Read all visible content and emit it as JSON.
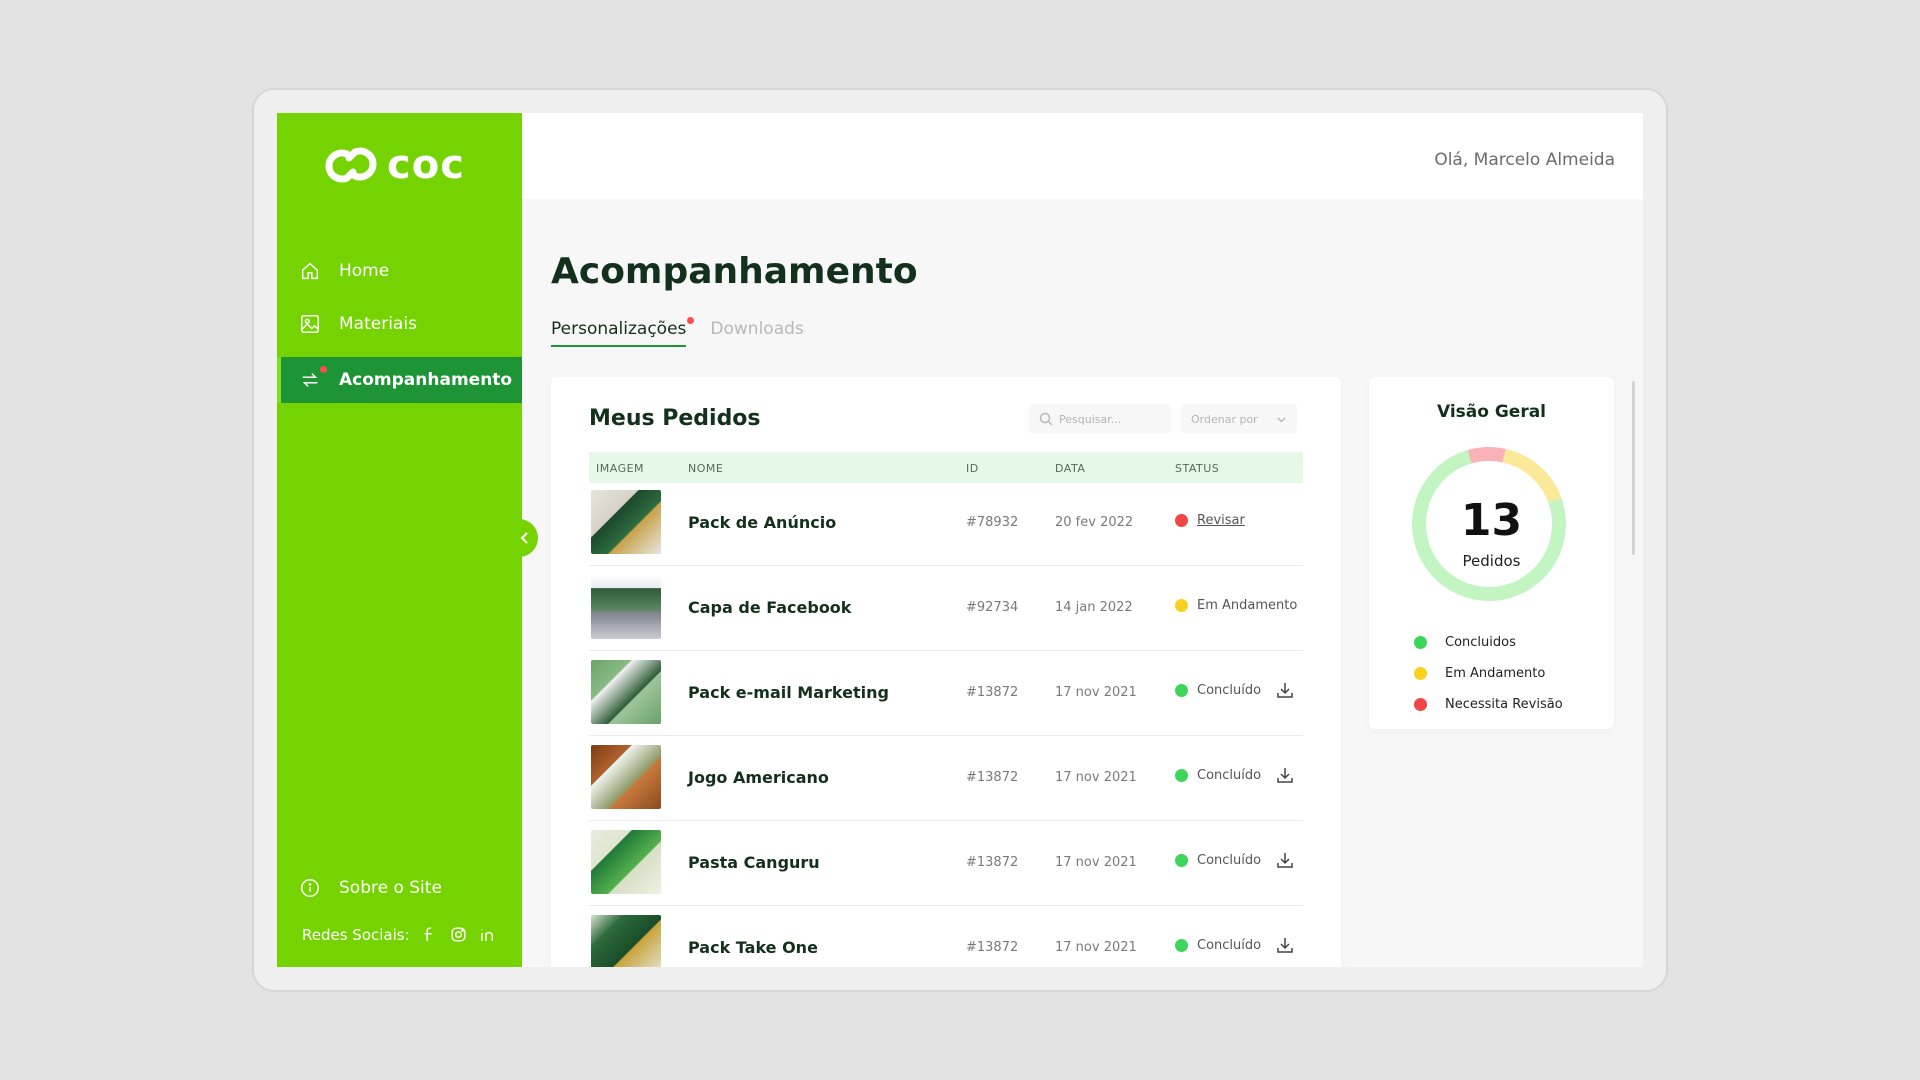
{
  "brand": {
    "logo_text": "coc",
    "primary": "#74d300",
    "active": "#1d9536"
  },
  "sidebar": {
    "items": [
      {
        "label": "Home",
        "icon": "home-icon"
      },
      {
        "label": "Materiais",
        "icon": "image-icon"
      },
      {
        "label": "Acompanhamento",
        "icon": "sync-icon",
        "active": true
      }
    ],
    "about_label": "Sobre o Site",
    "social_label": "Redes Sociais:",
    "social_icons": [
      "facebook-icon",
      "instagram-icon",
      "linkedin-icon"
    ]
  },
  "header": {
    "greeting": "Olá, Marcelo Almeida"
  },
  "page": {
    "title": "Acompanhamento",
    "tabs": [
      {
        "label": "Personalizações",
        "active": true
      },
      {
        "label": "Downloads",
        "active": false
      }
    ]
  },
  "orders": {
    "title": "Meus Pedidos",
    "search_placeholder": "Pesquisar...",
    "sort_label": "Ordenar por",
    "columns": [
      "IMAGEM",
      "NOME",
      "ID",
      "DATA",
      "STATUS"
    ],
    "rows": [
      {
        "name": "Pack de Anúncio",
        "id": "#78932",
        "date": "20 fev 2022",
        "status": "Revisar",
        "status_color": "#f04646",
        "download": false
      },
      {
        "name": "Capa de Facebook",
        "id": "#92734",
        "date": "14 jan 2022",
        "status": "Em Andamento",
        "status_color": "#f7d21e",
        "download": false
      },
      {
        "name": "Pack e-mail Marketing",
        "id": "#13872",
        "date": "17 nov 2021",
        "status": "Concluído",
        "status_color": "#3dd65a",
        "download": true
      },
      {
        "name": "Jogo Americano",
        "id": "#13872",
        "date": "17 nov 2021",
        "status": "Concluído",
        "status_color": "#3dd65a",
        "download": true
      },
      {
        "name": "Pasta Canguru",
        "id": "#13872",
        "date": "17 nov 2021",
        "status": "Concluído",
        "status_color": "#3dd65a",
        "download": true
      },
      {
        "name": "Pack Take One",
        "id": "#13872",
        "date": "17 nov 2021",
        "status": "Concluído",
        "status_color": "#3dd65a",
        "download": true
      }
    ]
  },
  "overview": {
    "title": "Visão Geral",
    "total": "13",
    "total_label": "Pedidos",
    "segments": [
      {
        "label": "Concluidos",
        "fraction": 0.76,
        "color": "#3dd65a",
        "ring_color": "#c3f5c3"
      },
      {
        "label": "Em Andamento",
        "fraction": 0.16,
        "color": "#f7d21e",
        "ring_color": "#fbe99a"
      },
      {
        "label": "Necessita Revisão",
        "fraction": 0.08,
        "color": "#f04646",
        "ring_color": "#f9b3b8"
      }
    ]
  }
}
